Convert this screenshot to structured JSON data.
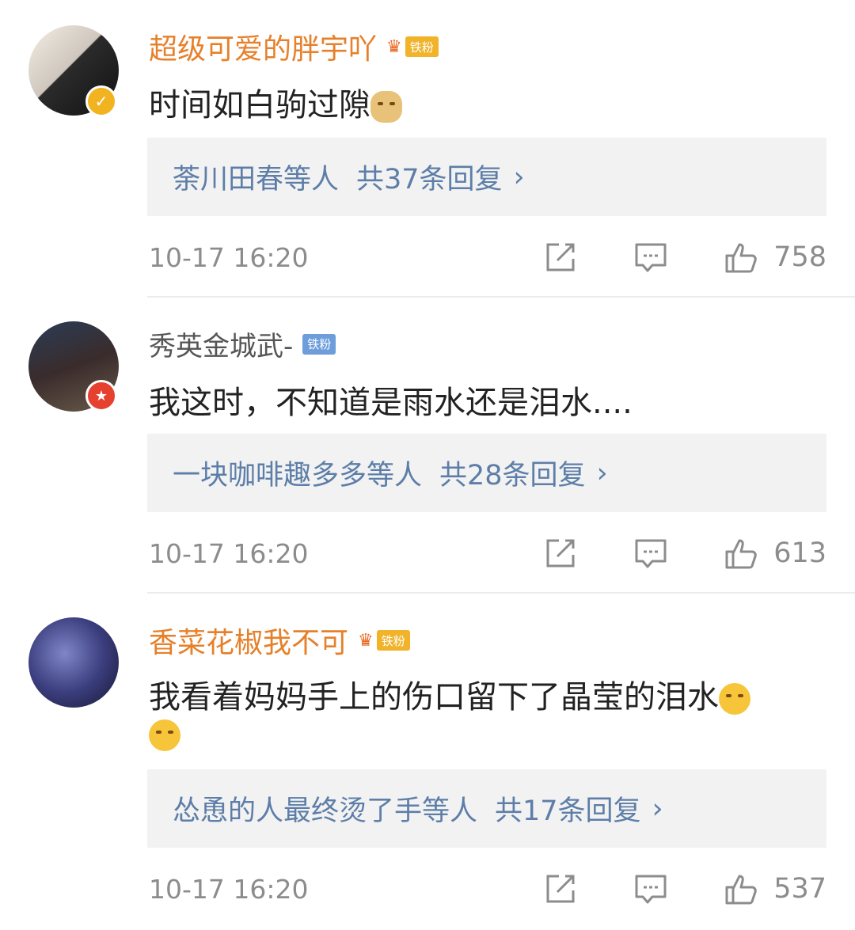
{
  "comments": [
    {
      "user": "超级可爱的胖宇吖",
      "fan_badge": "铁粉",
      "crown": "♛",
      "text": "时间如白驹过隙",
      "reply_users": "荼川田春等人",
      "reply_count": "共37条回复",
      "reply_chevron": "›",
      "time": "10-17 16:20",
      "likes": "758",
      "badge_icon": "✓"
    },
    {
      "user": "秀英金城武-",
      "fan_badge": "铁粉",
      "text": "我这时，不知道是雨水还是泪水....",
      "reply_users": "一块咖啡趣多多等人",
      "reply_count": "共28条回复",
      "reply_chevron": "›",
      "time": "10-17 16:20",
      "likes": "613",
      "badge_icon": "★"
    },
    {
      "user": "香菜花椒我不可",
      "fan_badge": "铁粉",
      "crown": "♛",
      "text": "我看着妈妈手上的伤口留下了晶莹的泪水",
      "reply_users": "怂恿的人最终烫了手等人",
      "reply_count": "共17条回复",
      "reply_chevron": "›",
      "time": "10-17 16:20",
      "likes": "537"
    }
  ],
  "colors": {
    "vip_name": "#e6802a",
    "link_blue": "#5d7ea8",
    "meta_gray": "#8c8c8c",
    "reply_bg": "#f2f2f2"
  }
}
